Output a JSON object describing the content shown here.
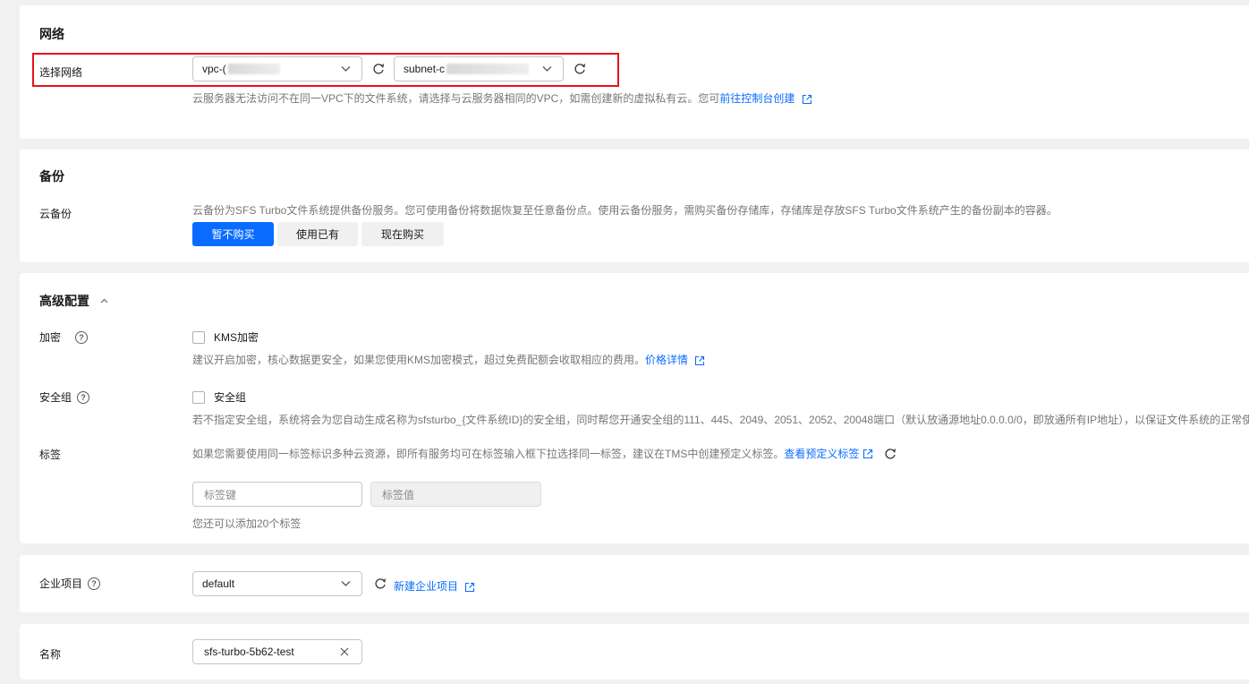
{
  "network": {
    "section_title": "网络",
    "field_label": "选择网络",
    "vpc_value": "vpc-(",
    "subnet_value": "subnet-c",
    "hint_text": "云服务器无法访问不在同一VPC下的文件系统，请选择与云服务器相同的VPC，如需创建新的虚拟私有云。您可",
    "hint_link": "前往控制台创建"
  },
  "backup": {
    "section_title": "备份",
    "field_label": "云备份",
    "hint_text": "云备份为SFS Turbo文件系统提供备份服务。您可使用备份将数据恢复至任意备份点。使用云备份服务，需购买备份存储库，存储库是存放SFS Turbo文件系统产生的备份副本的容器。",
    "buttons": [
      "暂不购买",
      "使用已有",
      "现在购买"
    ],
    "selected": "暂不购买"
  },
  "advanced": {
    "section_title": "高级配置",
    "encryption": {
      "label": "加密",
      "checkbox_label": "KMS加密",
      "checked": false,
      "hint_text": "建议开启加密，核心数据更安全，如果您使用KMS加密模式，超过免费配额会收取相应的费用。",
      "hint_link": "价格详情"
    },
    "security_group": {
      "label": "安全组",
      "checkbox_label": "安全组",
      "checked": false,
      "hint_text": "若不指定安全组，系统将会为您自动生成名称为sfsturbo_{文件系统ID}的安全组，同时帮您开通安全组的111、445、2049、2051、2052、20048端口（默认放通源地址0.0.0.0/0，即放通所有IP地址），以保证文件系统的正常使用。"
    },
    "tags": {
      "label": "标签",
      "hint_text": "如果您需要使用同一标签标识多种云资源，即所有服务均可在标签输入框下拉选择同一标签，建议在TMS中创建预定义标签。",
      "hint_link": "查看预定义标签",
      "key_placeholder": "标签键",
      "value_placeholder": "标签值",
      "remaining_text": "您还可以添加20个标签"
    }
  },
  "enterprise_project": {
    "label": "企业项目",
    "value": "default",
    "link": "新建企业项目"
  },
  "name": {
    "label": "名称",
    "value": "sfs-turbo-5b62-test"
  },
  "colors": {
    "primary": "#0a6cff",
    "highlight": "#e3141d",
    "background": "#f1f1f1"
  }
}
